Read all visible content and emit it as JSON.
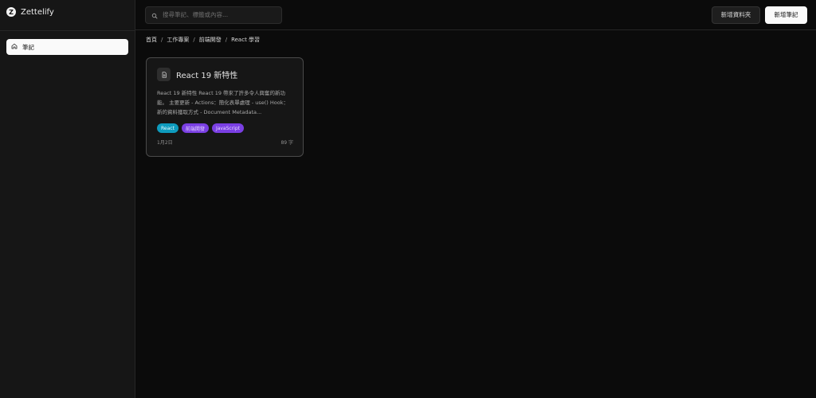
{
  "app": {
    "name": "Zettelify",
    "logo_letter": "Z"
  },
  "sidebar": {
    "items": [
      {
        "label": "筆記",
        "icon": "home-icon",
        "active": true
      }
    ]
  },
  "header": {
    "search": {
      "placeholder": "搜尋筆記、標籤或內容..."
    },
    "new_folder_label": "新增資料夾",
    "new_note_label": "新增筆記"
  },
  "breadcrumb": [
    "首頁",
    "工作專案",
    "前端開發",
    "React 學習"
  ],
  "breadcrumb_separator": "/",
  "notes": [
    {
      "title": "React 19 新特性",
      "excerpt": "React 19 新特性 React 19 帶來了許多令人興奮的新功能。 主要更新 - Actions：簡化表單處理 - use() Hook：新的資料獲取方式 - Document Metadata...",
      "tags": [
        "React",
        "前端開發",
        "JavaScript"
      ],
      "date": "1月2日",
      "word_count": "89 字"
    }
  ],
  "colors": {
    "background": "#0b0b0b",
    "sidebar": "#161616",
    "tag_react": "#0e9bbd",
    "tag_purple": "#7a3fe3",
    "primary_button": "#fafafa"
  }
}
